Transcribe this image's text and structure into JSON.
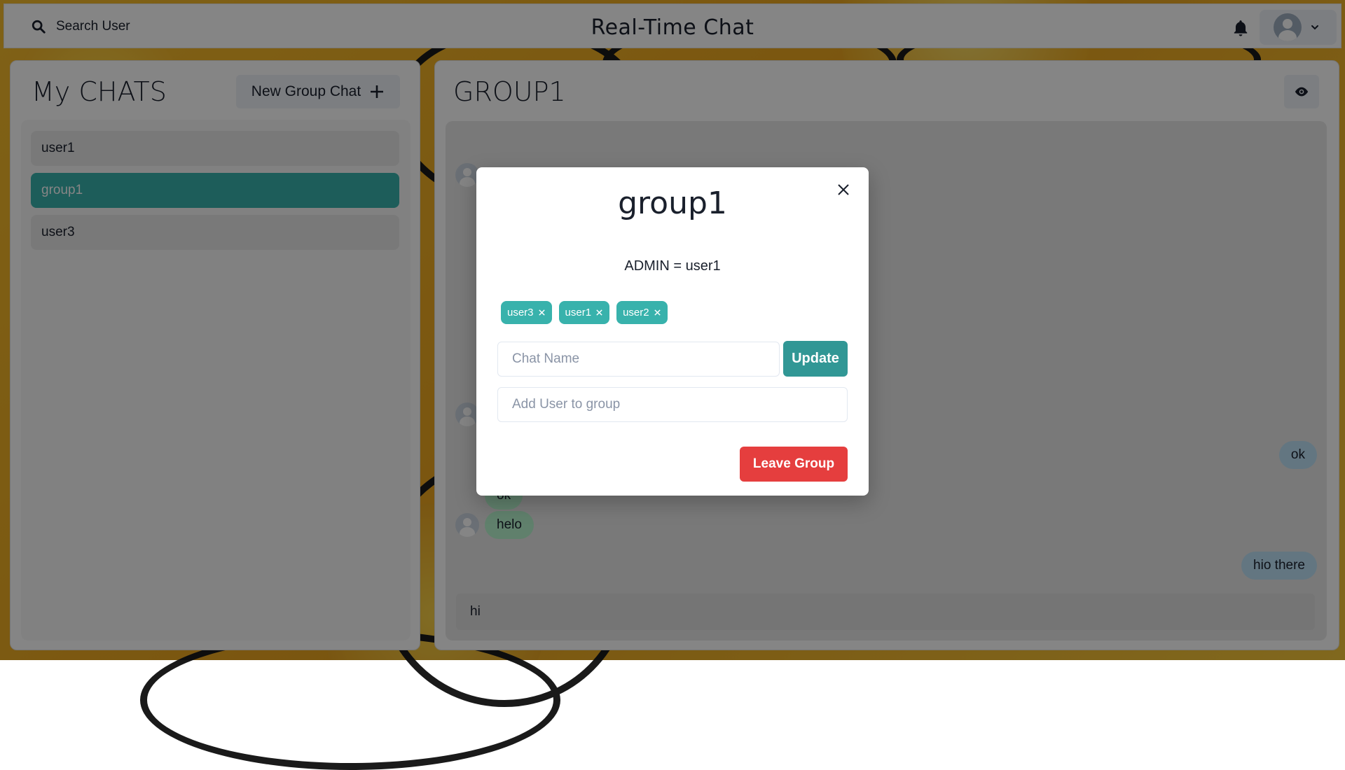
{
  "header": {
    "search_label": "Search User",
    "title": "Real-Time Chat"
  },
  "sidebar": {
    "title": "My CHATS",
    "new_group_label": "New Group Chat",
    "chats": [
      {
        "label": "user1",
        "active": false
      },
      {
        "label": "group1",
        "active": true
      },
      {
        "label": "user3",
        "active": false
      }
    ]
  },
  "chat": {
    "title": "GROUP1",
    "messages": [
      {
        "text": "ok",
        "side": "sent"
      },
      {
        "text": "ok",
        "side": "received"
      },
      {
        "text": "helo",
        "side": "received"
      },
      {
        "text": "hio there",
        "side": "sent"
      }
    ],
    "input_value": "hi"
  },
  "modal": {
    "title": "group1",
    "admin_text": "ADMIN = user1",
    "members": [
      "user3",
      "user1",
      "user2"
    ],
    "chat_name_placeholder": "Chat Name",
    "update_label": "Update",
    "add_user_placeholder": "Add User to group",
    "leave_label": "Leave Group"
  },
  "colors": {
    "accent": "#38b2ac",
    "update_button": "#319795",
    "danger": "#e53e3e",
    "received_bubble": "#b9f5d0",
    "sent_bubble": "#bee3f8"
  }
}
